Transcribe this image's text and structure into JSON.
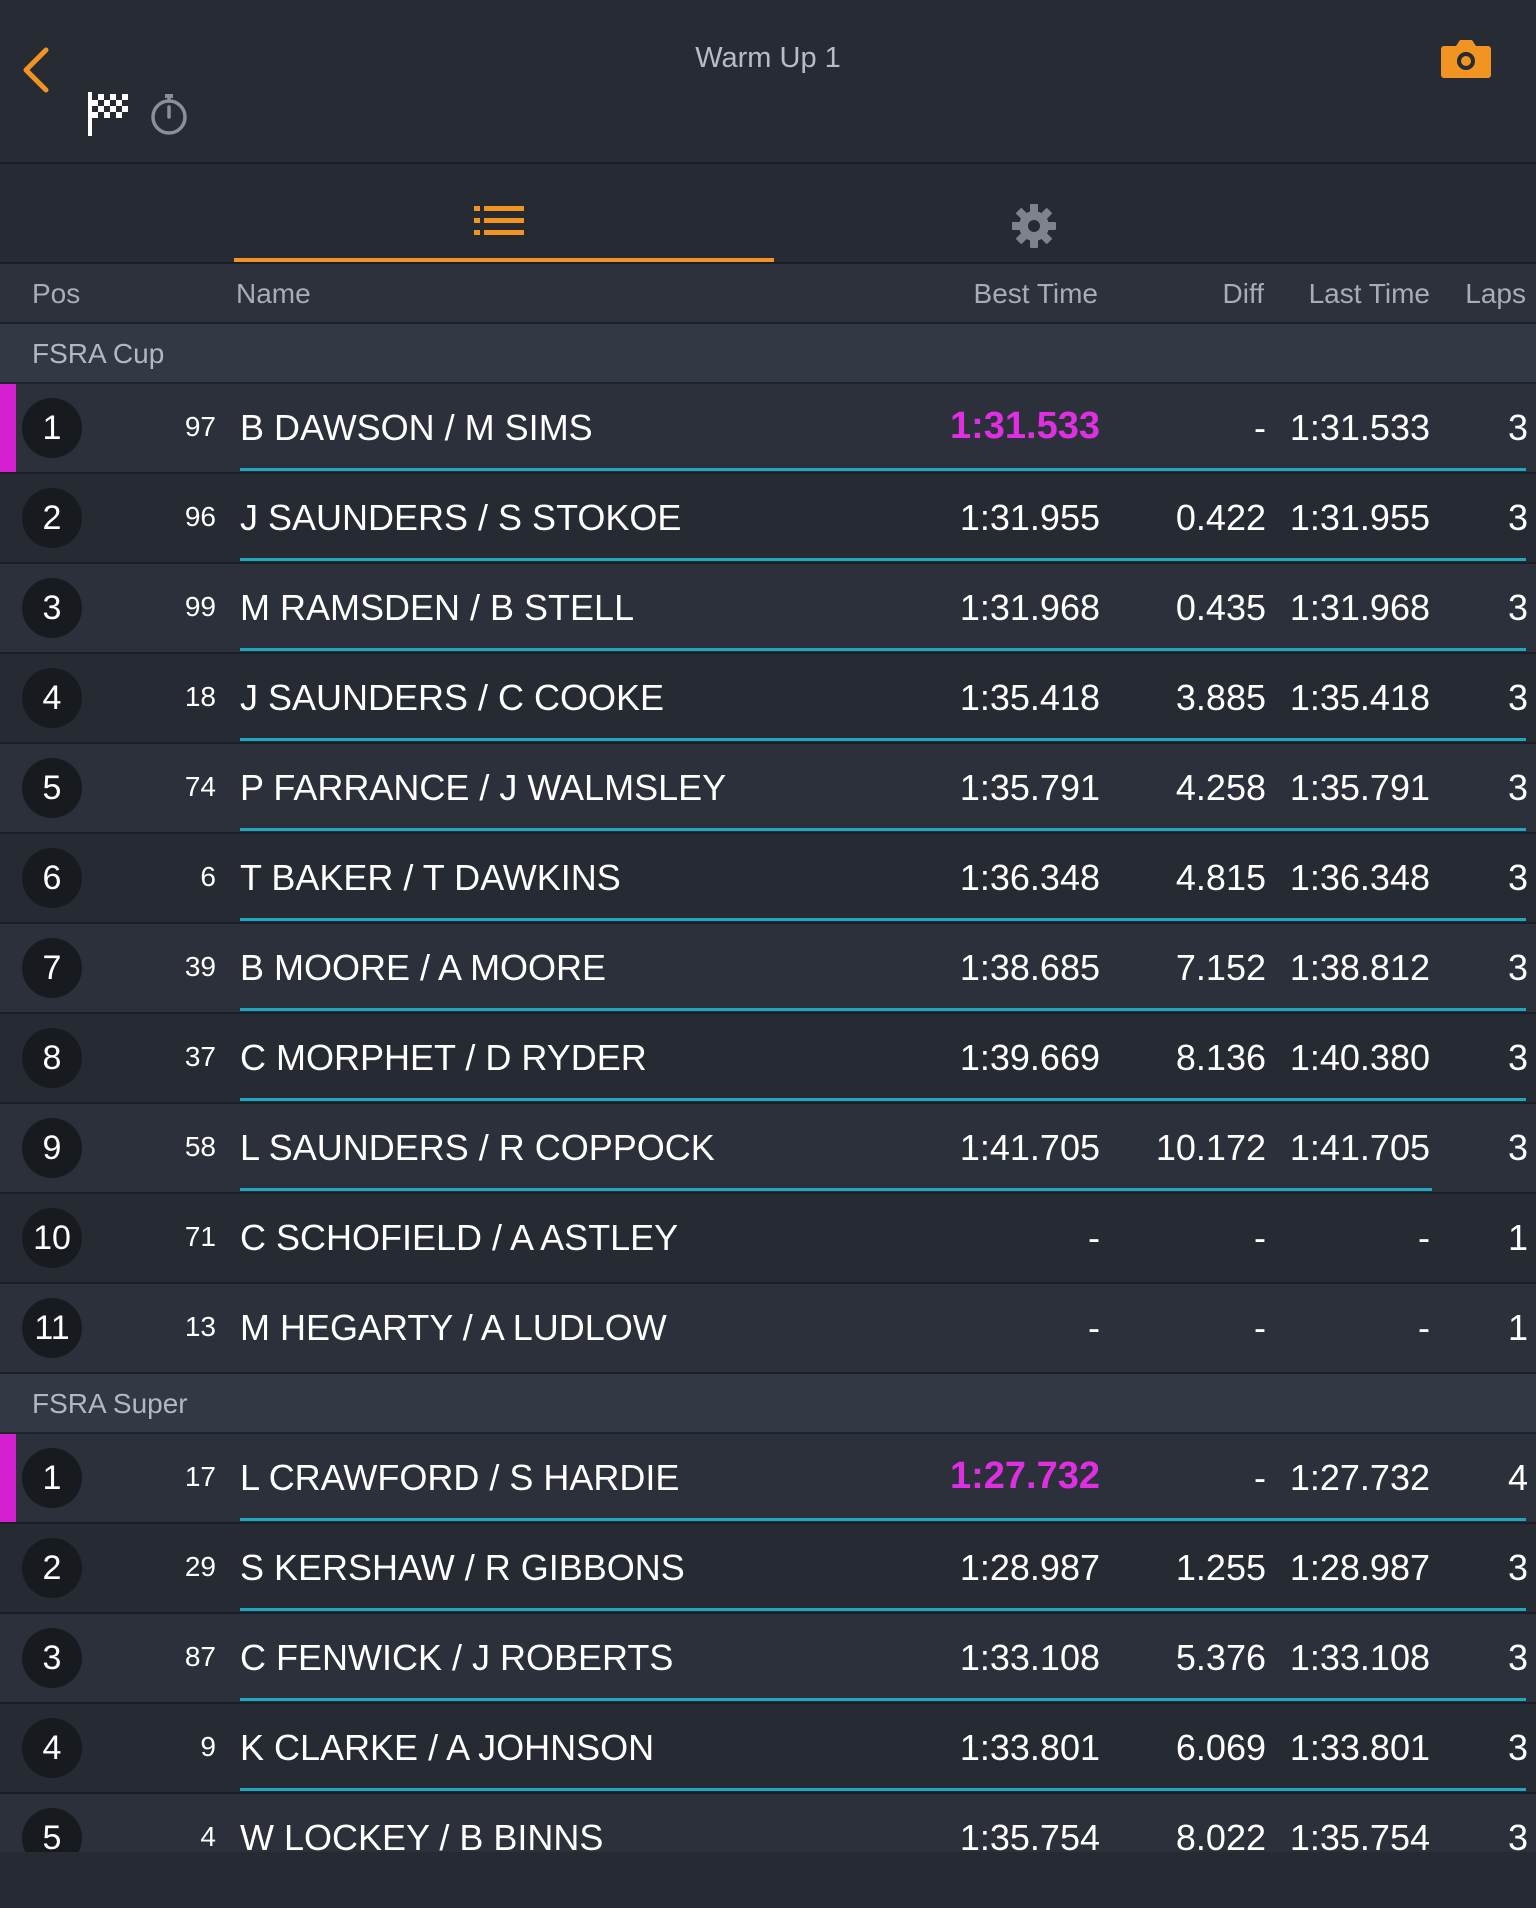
{
  "header": {
    "title": "Warm Up 1"
  },
  "colors": {
    "accent": "#f29422",
    "fastest": "#e02ee3",
    "row_line": "#1fa7c0"
  },
  "columns": {
    "pos": "Pos",
    "name": "Name",
    "best": "Best Time",
    "diff": "Diff",
    "last": "Last Time",
    "laps": "Laps"
  },
  "groups": [
    {
      "name": "FSRA Cup",
      "rows": [
        {
          "pos": "1",
          "num": "97",
          "name": "B DAWSON / M SIMS",
          "best": "1:31.533",
          "diff": "-",
          "last": "1:31.533",
          "laps": "3",
          "leader": true
        },
        {
          "pos": "2",
          "num": "96",
          "name": "J SAUNDERS / S STOKOE",
          "best": "1:31.955",
          "diff": "0.422",
          "last": "1:31.955",
          "laps": "3"
        },
        {
          "pos": "3",
          "num": "99",
          "name": "M RAMSDEN / B STELL",
          "best": "1:31.968",
          "diff": "0.435",
          "last": "1:31.968",
          "laps": "3"
        },
        {
          "pos": "4",
          "num": "18",
          "name": "J SAUNDERS / C COOKE",
          "best": "1:35.418",
          "diff": "3.885",
          "last": "1:35.418",
          "laps": "3"
        },
        {
          "pos": "5",
          "num": "74",
          "name": "P FARRANCE / J WALMSLEY",
          "best": "1:35.791",
          "diff": "4.258",
          "last": "1:35.791",
          "laps": "3"
        },
        {
          "pos": "6",
          "num": "6",
          "name": "T BAKER / T DAWKINS",
          "best": "1:36.348",
          "diff": "4.815",
          "last": "1:36.348",
          "laps": "3"
        },
        {
          "pos": "7",
          "num": "39",
          "name": "B MOORE / A MOORE",
          "best": "1:38.685",
          "diff": "7.152",
          "last": "1:38.812",
          "laps": "3"
        },
        {
          "pos": "8",
          "num": "37",
          "name": "C MORPHET / D RYDER",
          "best": "1:39.669",
          "diff": "8.136",
          "last": "1:40.380",
          "laps": "3"
        },
        {
          "pos": "9",
          "num": "58",
          "name": "L SAUNDERS / R COPPOCK",
          "best": "1:41.705",
          "diff": "10.172",
          "last": "1:41.705",
          "laps": "3"
        },
        {
          "pos": "10",
          "num": "71",
          "name": "C SCHOFIELD / A ASTLEY",
          "best": "-",
          "diff": "-",
          "last": "-",
          "laps": "1"
        },
        {
          "pos": "11",
          "num": "13",
          "name": "M HEGARTY / A LUDLOW",
          "best": "-",
          "diff": "-",
          "last": "-",
          "laps": "1"
        }
      ]
    },
    {
      "name": "FSRA Super",
      "rows": [
        {
          "pos": "1",
          "num": "17",
          "name": "L CRAWFORD / S HARDIE",
          "best": "1:27.732",
          "diff": "-",
          "last": "1:27.732",
          "laps": "4",
          "leader": true
        },
        {
          "pos": "2",
          "num": "29",
          "name": "S KERSHAW / R GIBBONS",
          "best": "1:28.987",
          "diff": "1.255",
          "last": "1:28.987",
          "laps": "3"
        },
        {
          "pos": "3",
          "num": "87",
          "name": "C FENWICK / J ROBERTS",
          "best": "1:33.108",
          "diff": "5.376",
          "last": "1:33.108",
          "laps": "3"
        },
        {
          "pos": "4",
          "num": "9",
          "name": "K CLARKE / A JOHNSON",
          "best": "1:33.801",
          "diff": "6.069",
          "last": "1:33.801",
          "laps": "3"
        },
        {
          "pos": "5",
          "num": "4",
          "name": "W LOCKEY / B BINNS",
          "best": "1:35.754",
          "diff": "8.022",
          "last": "1:35.754",
          "laps": "3"
        }
      ]
    }
  ]
}
